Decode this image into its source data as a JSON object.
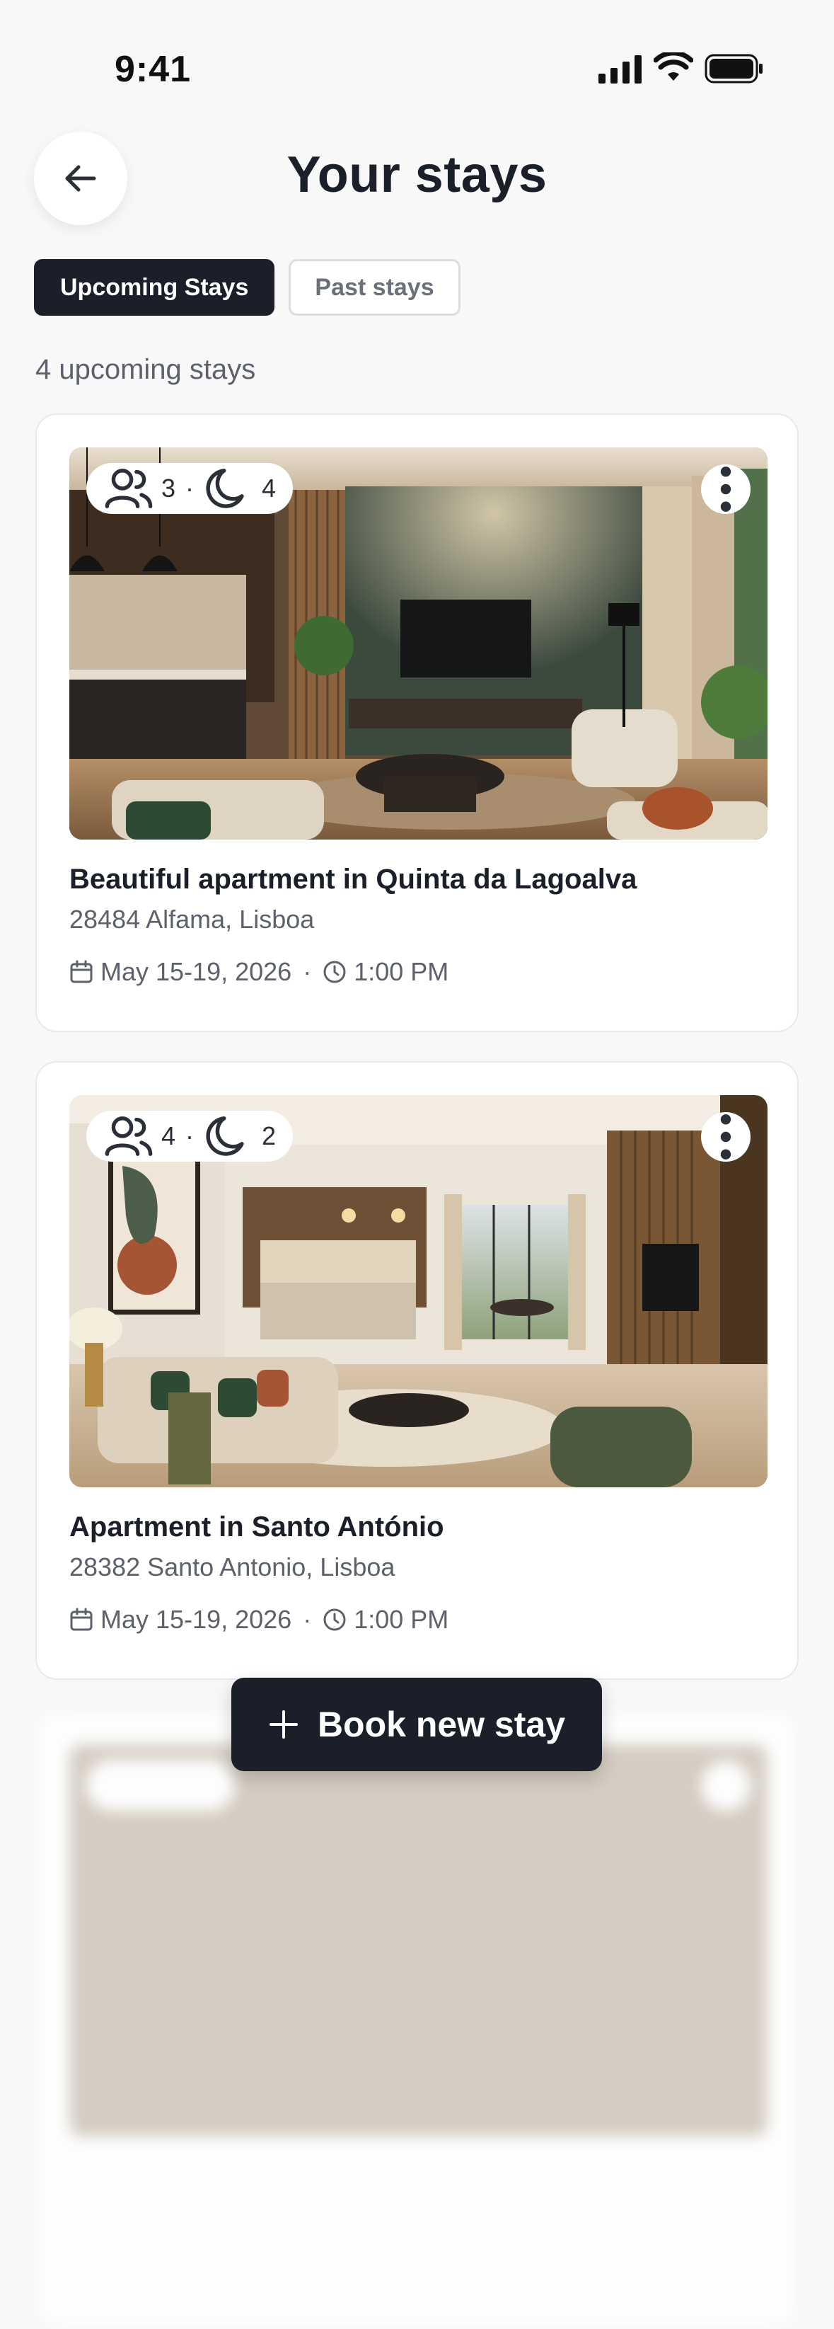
{
  "status_bar": {
    "time": "9:41"
  },
  "header": {
    "title": "Your stays"
  },
  "tabs": [
    {
      "label": "Upcoming Stays",
      "active": true
    },
    {
      "label": "Past stays",
      "active": false
    }
  ],
  "upcoming_count_label": "4 upcoming stays",
  "stays": [
    {
      "guests": "3",
      "nights": "4",
      "title": "Beautiful apartment in Quinta da Lagoalva",
      "address": "28484 Alfama, Lisboa",
      "dates": "May 15-19, 2026",
      "time": "1:00 PM"
    },
    {
      "guests": "4",
      "nights": "2",
      "title": "Apartment in Santo António",
      "address": "28382 Santo Antonio, Lisboa",
      "dates": "May 15-19, 2026",
      "time": "1:00 PM"
    }
  ],
  "separator": "·",
  "book_button": {
    "label": "Book new stay"
  },
  "colors": {
    "primary": "#1b1f2a",
    "background": "#f8f8f9",
    "muted_text": "#5d616b"
  }
}
